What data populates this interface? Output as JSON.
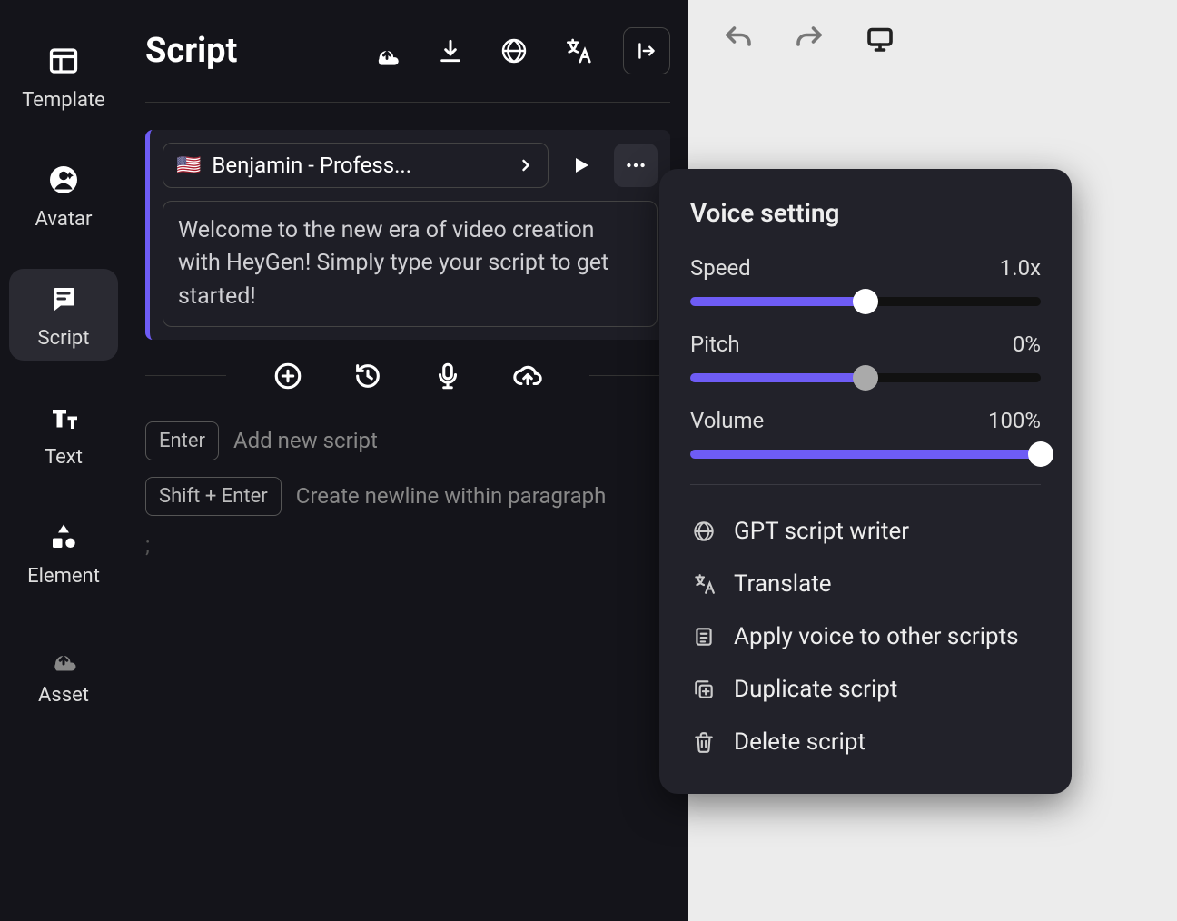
{
  "sidebar": {
    "items": [
      {
        "label": "Template"
      },
      {
        "label": "Avatar"
      },
      {
        "label": "Script"
      },
      {
        "label": "Text"
      },
      {
        "label": "Element"
      },
      {
        "label": "Asset"
      }
    ]
  },
  "header": {
    "title": "Script"
  },
  "script": {
    "voice_flag": "🇺🇸",
    "voice_name": "Benjamin - Profess...",
    "text": "Welcome to the new era of video creation with HeyGen! Simply type your script to get started!"
  },
  "hints": {
    "enter_key": "Enter",
    "enter_text": "Add new script",
    "shift_key": "Shift + Enter",
    "shift_text": "Create newline within paragraph"
  },
  "stray": ";",
  "popover": {
    "title": "Voice setting",
    "speed": {
      "label": "Speed",
      "value": "1.0x",
      "percent": 50
    },
    "pitch": {
      "label": "Pitch",
      "value": "0%",
      "percent": 50
    },
    "volume": {
      "label": "Volume",
      "value": "100%",
      "percent": 100
    },
    "actions": {
      "gpt": "GPT script writer",
      "translate": "Translate",
      "apply": "Apply voice to other scripts",
      "duplicate": "Duplicate script",
      "delete": "Delete script"
    }
  }
}
